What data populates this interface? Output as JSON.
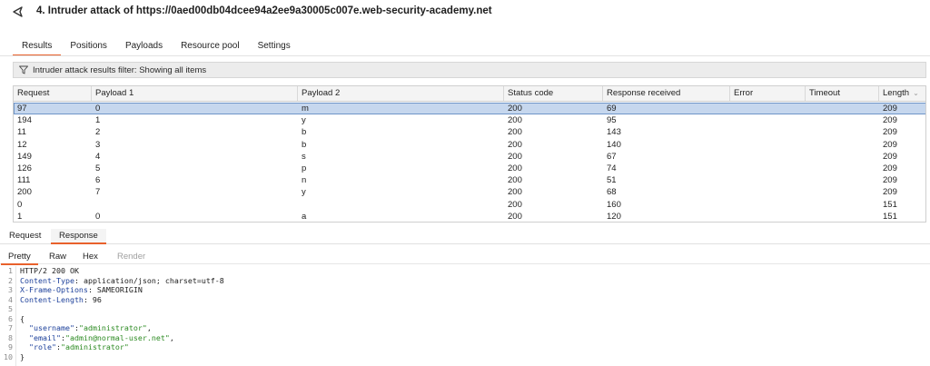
{
  "window": {
    "title": "4. Intruder attack of https://0aed00db04dcee94a2ee9a30005c007e.web-security-academy.net",
    "icon": "burp-intruder-icon"
  },
  "top_tabs": [
    "Results",
    "Positions",
    "Payloads",
    "Resource pool",
    "Settings"
  ],
  "active_top_tab": "Results",
  "filter": {
    "label": "Intruder attack results filter: Showing all items",
    "icon": "filter-icon"
  },
  "results_table": {
    "columns": [
      "Request",
      "Payload 1",
      "Payload 2",
      "Status code",
      "Response received",
      "Error",
      "Timeout",
      "Length"
    ],
    "sort_column": "Length",
    "sort_direction": "descending",
    "rows": [
      [
        "97",
        "0",
        "m",
        "200",
        "69",
        "",
        "",
        "209"
      ],
      [
        "194",
        "1",
        "y",
        "200",
        "95",
        "",
        "",
        "209"
      ],
      [
        "11",
        "2",
        "b",
        "200",
        "143",
        "",
        "",
        "209"
      ],
      [
        "12",
        "3",
        "b",
        "200",
        "140",
        "",
        "",
        "209"
      ],
      [
        "149",
        "4",
        "s",
        "200",
        "67",
        "",
        "",
        "209"
      ],
      [
        "126",
        "5",
        "p",
        "200",
        "74",
        "",
        "",
        "209"
      ],
      [
        "111",
        "6",
        "n",
        "200",
        "51",
        "",
        "",
        "209"
      ],
      [
        "200",
        "7",
        "y",
        "200",
        "68",
        "",
        "",
        "209"
      ],
      [
        "0",
        "",
        "",
        "200",
        "160",
        "",
        "",
        "151"
      ],
      [
        "1",
        "0",
        "a",
        "200",
        "120",
        "",
        "",
        "151"
      ]
    ],
    "selected_row": 0
  },
  "request_response_tabs": [
    "Request",
    "Response"
  ],
  "active_rr_tab": "Response",
  "view_tabs": [
    "Pretty",
    "Raw",
    "Hex",
    "Render"
  ],
  "active_view_tab": "Pretty",
  "response_lines": [
    {
      "n": "1",
      "text": "HTTP/2 200 OK"
    },
    {
      "n": "2",
      "key": "Content-Type",
      "value": " application/json; charset=utf-8"
    },
    {
      "n": "3",
      "key": "X-Frame-Options",
      "value": " SAMEORIGIN"
    },
    {
      "n": "4",
      "key": "Content-Length",
      "value": " 96"
    },
    {
      "n": "5",
      "text": ""
    },
    {
      "n": "6",
      "text": "{"
    },
    {
      "n": "7",
      "jkey": "\"username\"",
      "jval": "\"administrator\"",
      "tail": ","
    },
    {
      "n": "8",
      "jkey": "\"email\"",
      "jval": "\"admin@normal-user.net\"",
      "tail": ","
    },
    {
      "n": "9",
      "jkey": "\"role\"",
      "jval": "\"administrator\"",
      "tail": ""
    },
    {
      "n": "10",
      "text": "}"
    }
  ],
  "colors": {
    "accent": "#e8612c",
    "selected_row": "#c6d7ee",
    "header_key": "#1b3f9a",
    "json_value": "#2b8a21"
  }
}
